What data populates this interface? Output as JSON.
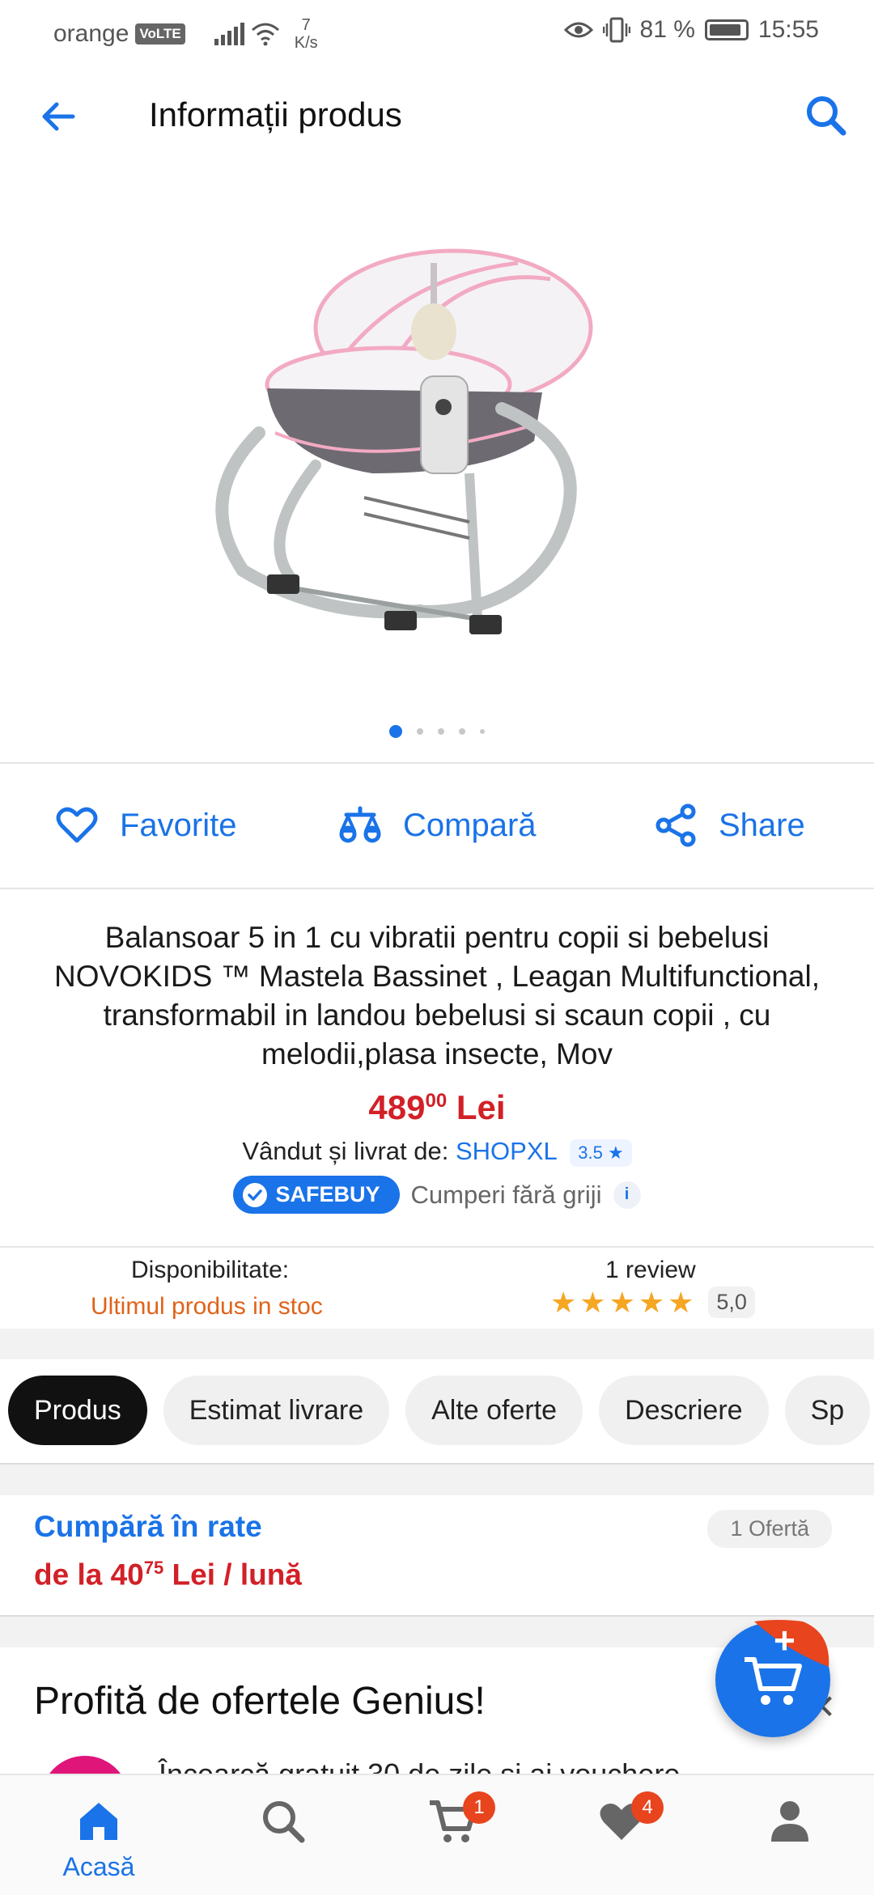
{
  "status_bar": {
    "carrier": "orange",
    "volte": "VoLTE",
    "speed_value": "7",
    "speed_unit": "K/s",
    "battery": "81 %",
    "time": "15:55"
  },
  "header": {
    "title": "Informații produs"
  },
  "gallery": {
    "image_alt": "Balansoar 5 in 1",
    "total_images": 5,
    "active_index": 1
  },
  "actions": {
    "favorite": "Favorite",
    "compare": "Compară",
    "share": "Share"
  },
  "product": {
    "title": "Balansoar 5 in 1 cu vibratii pentru copii si bebelusi NOVOKIDS ™ Mastela Bassinet , Leagan Multifunctional, transformabil in landou bebelusi si scaun copii , cu melodii,plasa insecte, Mov",
    "price_int": "489",
    "price_dec": "00",
    "price_currency": "Lei",
    "seller_label": "Vândut și livrat de:",
    "seller_name": "SHOPXL",
    "seller_rating": "3.5",
    "safebuy_label": "SAFEBUY",
    "safebuy_text": "Cumperi fără griji",
    "availability_label": "Disponibilitate:",
    "availability_value": "Ultimul produs in stoc",
    "reviews_label": "1 review",
    "rating_score": "5,0",
    "rating_stars": 5
  },
  "tabs": [
    {
      "label": "Produs",
      "active": true
    },
    {
      "label": "Estimat livrare",
      "active": false
    },
    {
      "label": "Alte oferte",
      "active": false
    },
    {
      "label": "Descriere",
      "active": false
    },
    {
      "label": "Sp",
      "active": false
    }
  ],
  "installments": {
    "title": "Cumpără în rate",
    "prefix": "de la",
    "amount_int": "40",
    "amount_dec": "75",
    "suffix": "Lei / lună",
    "offers": "1 Ofertă"
  },
  "genius": {
    "title": "Profită de ofertele Genius!",
    "subtitle": "Încearcă gratuit 30 de zile și ai vouchere"
  },
  "fab": {
    "plus": "+"
  },
  "bottom_nav": {
    "home_label": "Acasă",
    "cart_badge": "1",
    "favorites_badge": "4"
  },
  "colors": {
    "accent": "#1a73e8",
    "price": "#d22027",
    "stock_warning": "#e0631a",
    "star": "#f5a623",
    "badge": "#e8441e"
  }
}
